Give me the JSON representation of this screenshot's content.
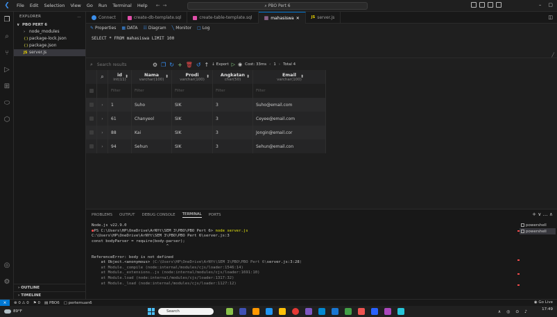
{
  "titlebar": {
    "menu": [
      "File",
      "Edit",
      "Selection",
      "View",
      "Go",
      "Run",
      "Terminal",
      "Help"
    ],
    "command_center": "PBO Pert 6"
  },
  "sidebar": {
    "header": "EXPLORER",
    "root": "PBO PERT 6",
    "items": [
      {
        "label": "node_modules",
        "icon": "chevron-right"
      },
      {
        "label": "package-lock.json",
        "icon": "json"
      },
      {
        "label": "package.json",
        "icon": "json"
      },
      {
        "label": "server.js",
        "icon": "js"
      }
    ],
    "outline": "OUTLINE",
    "timeline": "TIMELINE"
  },
  "tabs": [
    {
      "label": "Connect",
      "kind": "connect"
    },
    {
      "label": "create-db-template.sql",
      "kind": "sql"
    },
    {
      "label": "create-table-template.sql",
      "kind": "sql"
    },
    {
      "label": "mahasiswa",
      "kind": "table",
      "active": true
    },
    {
      "label": "server.js",
      "kind": "js"
    }
  ],
  "subbar": {
    "properties": "Properties",
    "data": "DATA",
    "diagram": "Diagram",
    "monitor": "Monitor",
    "log": "Log"
  },
  "query": "SELECT * FROM mahasiswa LIMIT 100",
  "results": {
    "search_placeholder": "Search results",
    "export": "Export",
    "cost": "Cost: 33ms",
    "page": "1",
    "total": "Total 4"
  },
  "table": {
    "columns": [
      {
        "name": "id",
        "type": "int(11)"
      },
      {
        "name": "Nama",
        "type": "varchar(100)"
      },
      {
        "name": "Prodi",
        "type": "varchar(100)"
      },
      {
        "name": "Angkatan",
        "type": "char(50)"
      },
      {
        "name": "Email",
        "type": "varchar(100)"
      }
    ],
    "filter_label": "Filter",
    "rows": [
      [
        "1",
        "Suho",
        "SIK",
        "3",
        "Suho@email.com"
      ],
      [
        "61",
        "Chanyeol",
        "SIK",
        "3",
        "Ceyee@email.com"
      ],
      [
        "88",
        "Kai",
        "SIK",
        "3",
        "Jongin@email.cor"
      ],
      [
        "94",
        "Sehun",
        "SIK",
        "3",
        "Sehun@email.con"
      ]
    ]
  },
  "panel": {
    "tabs": [
      "PROBLEMS",
      "OUTPUT",
      "DEBUG CONSOLE",
      "TERMINAL",
      "PORTS"
    ],
    "active_tab": "TERMINAL",
    "terminal": {
      "l1": "Node.js v22.9.0",
      "l2_prefix": "PS C:\\Users\\HP\\OneDrive\\ArNYt\\SEM 3\\PBO\\PBO Pert 6> ",
      "l2_cmd": "node server.js",
      "l3": "C:\\Users\\HP\\OneDrive\\ArNYt\\SEM 3\\PBO\\PBO Pert 6\\server.js:3",
      "l4": "const bodyParser = require(body-parser);",
      "l5": "                                ^",
      "l6": "ReferenceError: body is not defined",
      "l7a": "    at Object.<anonymous> ",
      "l7b": "(C:\\Users\\HP\\OneDrive\\ArNYt\\SEM 3\\PBO\\PBO Pert 6\\",
      "l7c": "server.js:3:28",
      "l7d": ")",
      "l8": "    at Module._compile (node:internal/modules/cjs/loader:1546:14)",
      "l9": "    at Module._extensions..js (node:internal/modules/cjs/loader:1691:10)",
      "l10": "    at Module.load (node:internal/modules/cjs/loader:1317:32)",
      "l11": "    at Module._load (node:internal/modules/cjs/loader:1127:12)"
    },
    "shells": [
      "powershell",
      "powershell"
    ]
  },
  "status": {
    "problems": "⊗ 0 ⚠ 0",
    "ports": "⚑ 0",
    "project": "PBO6",
    "folder": "pertemuan6",
    "golive": "Go Live"
  },
  "taskbar": {
    "weather": "89°F",
    "search": "Search",
    "time": "17:49"
  },
  "colors": {
    "accent": "#0078d4",
    "error": "#f14c4c",
    "json": "#cbcb41",
    "js": "#f1d900"
  }
}
